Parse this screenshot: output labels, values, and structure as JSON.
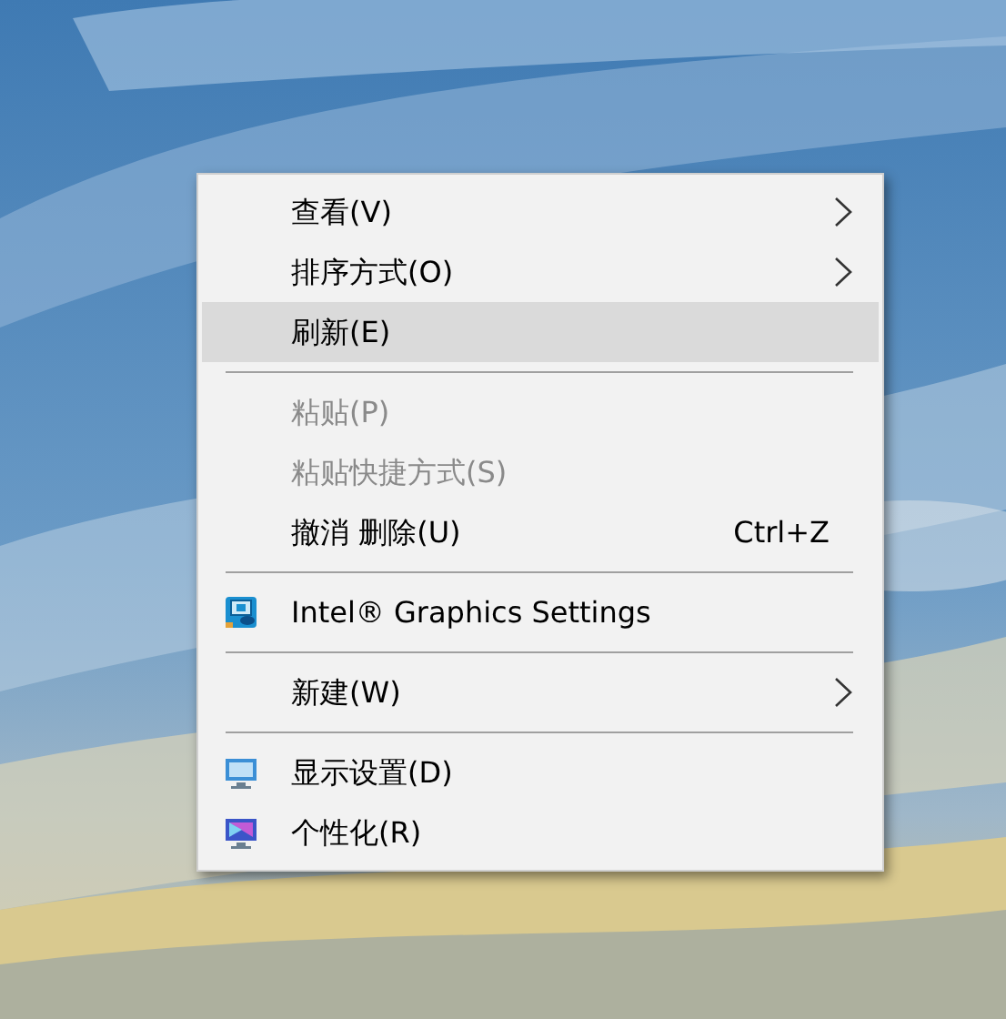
{
  "menu": {
    "items": [
      {
        "kind": "item",
        "label": "查看(V)",
        "submenu": true,
        "disabled": false,
        "selected": false
      },
      {
        "kind": "item",
        "label": "排序方式(O)",
        "submenu": true,
        "disabled": false,
        "selected": false
      },
      {
        "kind": "item",
        "label": "刷新(E)",
        "submenu": false,
        "disabled": false,
        "selected": true
      },
      {
        "kind": "separator"
      },
      {
        "kind": "item",
        "label": "粘贴(P)",
        "submenu": false,
        "disabled": true,
        "selected": false
      },
      {
        "kind": "item",
        "label": "粘贴快捷方式(S)",
        "submenu": false,
        "disabled": true,
        "selected": false
      },
      {
        "kind": "item",
        "label": "撤消 删除(U)",
        "shortcut": "Ctrl+Z",
        "submenu": false,
        "disabled": false,
        "selected": false
      },
      {
        "kind": "separator"
      },
      {
        "kind": "graphics",
        "label": "Intel® Graphics Settings",
        "submenu": false,
        "disabled": false,
        "selected": false
      },
      {
        "kind": "separator"
      },
      {
        "kind": "item",
        "label": "新建(W)",
        "submenu": true,
        "disabled": false,
        "selected": false
      },
      {
        "kind": "separator"
      },
      {
        "kind": "display",
        "label": "显示设置(D)",
        "submenu": false,
        "disabled": false,
        "selected": false
      },
      {
        "kind": "personalize",
        "label": "个性化(R)",
        "submenu": false,
        "disabled": false,
        "selected": false
      }
    ]
  }
}
